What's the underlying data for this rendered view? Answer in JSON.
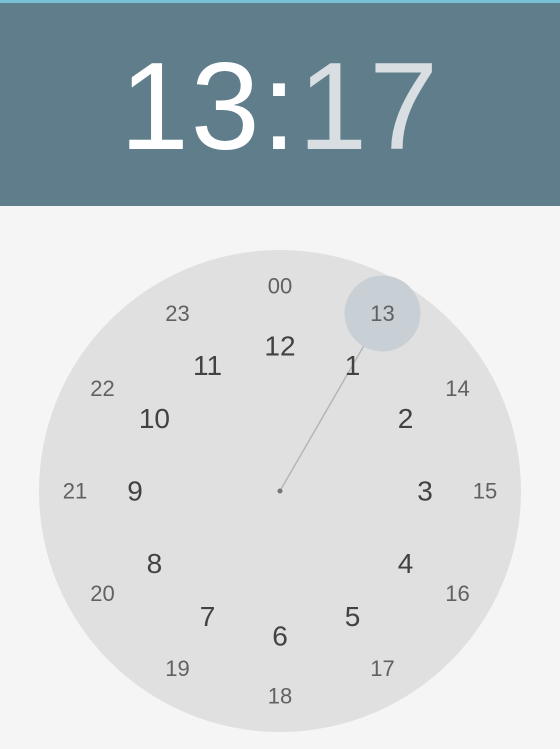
{
  "header": {
    "hour": "13",
    "separator": ":",
    "minute": "17"
  },
  "dial": {
    "selected_hour": "13",
    "outer_ring": [
      "12",
      "1",
      "2",
      "3",
      "4",
      "5",
      "6",
      "7",
      "8",
      "9",
      "10",
      "11"
    ],
    "inner_ring": [
      "00",
      "13",
      "14",
      "15",
      "16",
      "17",
      "18",
      "19",
      "20",
      "21",
      "22",
      "23"
    ]
  },
  "colors": {
    "header_bg": "#607d8b",
    "dial_bg": "#e0e0e0",
    "selector": "#c8cfd5",
    "hand": "#b0b8bd"
  }
}
